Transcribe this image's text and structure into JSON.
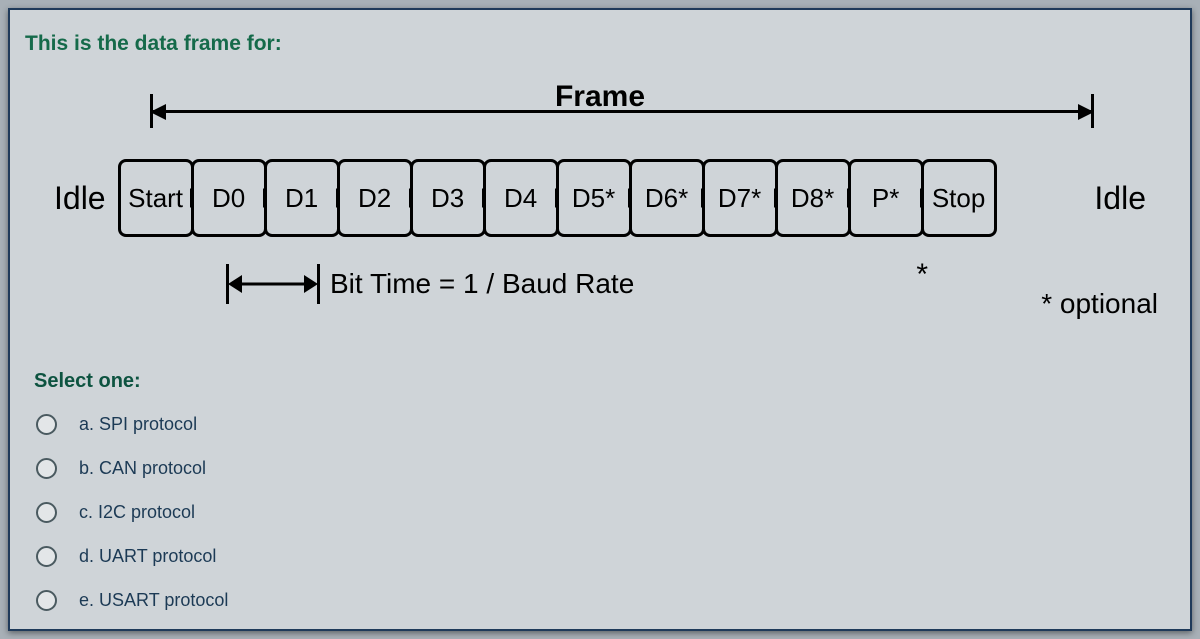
{
  "question_text": "This is the data frame for:",
  "diagram": {
    "frame_label": "Frame",
    "idle_left": "Idle",
    "idle_right": "Idle",
    "asterisk": "*",
    "bits": [
      "Start",
      "D0",
      "D1",
      "D2",
      "D3",
      "D4",
      "D5*",
      "D6*",
      "D7*",
      "D8*",
      "P*",
      "Stop"
    ],
    "bit_time_label": "Bit Time = 1 / Baud Rate",
    "optional_note": "* optional"
  },
  "select_one_label": "Select one:",
  "options": [
    {
      "key": "a",
      "label": "a. SPI protocol"
    },
    {
      "key": "b",
      "label": "b. CAN protocol"
    },
    {
      "key": "c",
      "label": "c. I2C protocol"
    },
    {
      "key": "d",
      "label": "d. UART protocol"
    },
    {
      "key": "e",
      "label": "e. USART protocol"
    }
  ]
}
